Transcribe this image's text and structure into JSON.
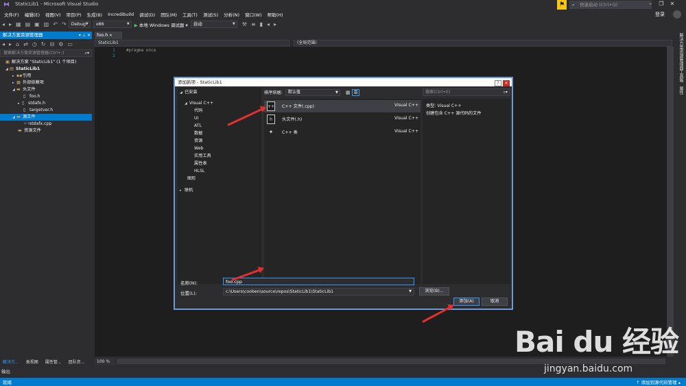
{
  "window": {
    "title": "StaticLib1 - Microsoft Visual Studio",
    "quick_launch_placeholder": "快速启动 (Ctrl+Q)",
    "login": "登录"
  },
  "menu": [
    "文件(F)",
    "编辑(E)",
    "视图(V)",
    "项目(P)",
    "生成(B)",
    "Incredibuild",
    "调试(D)",
    "团队(M)",
    "工具(T)",
    "测试(S)",
    "分析(N)",
    "窗口(W)",
    "帮助(H)"
  ],
  "toolbar": {
    "config": "Debug",
    "platform": "x86",
    "run_label": "本地 Windows 调试器",
    "run_mode": "自动"
  },
  "solution_explorer": {
    "header": "解决方案资源管理器",
    "search_placeholder": "搜索解决方案资源管理器(Ctrl+;)",
    "items": [
      {
        "label": "解决方案 \"StaticLib1\" (1 个项目)"
      },
      {
        "label": "StaticLib1"
      },
      {
        "label": "引用"
      },
      {
        "label": "外部依赖项"
      },
      {
        "label": "头文件"
      },
      {
        "label": "foo.h"
      },
      {
        "label": "stdafx.h"
      },
      {
        "label": "targetver.h"
      },
      {
        "label": "源文件"
      },
      {
        "label": "stdafx.cpp"
      },
      {
        "label": "资源文件"
      }
    ],
    "bottom_tabs": [
      "解决方...",
      "类视图",
      "属性管...",
      "团队资..."
    ]
  },
  "editor": {
    "tab": "foo.h",
    "nav_left": "StaticLib1",
    "nav_right": "(全局范围)",
    "line_numbers": [
      "1",
      "2"
    ],
    "code": "#pragma once",
    "zoom": "100 %"
  },
  "right_strip": [
    "解决方案资源管理器",
    "工具箱",
    "属性"
  ],
  "output_tab": "输出",
  "status": {
    "left": "就绪",
    "right": "添加到源代码管理"
  },
  "dialog": {
    "title": "添加新项 - StaticLib1",
    "categories_root": "已安装",
    "visual_cpp": "Visual C++",
    "subcategories": [
      "代码",
      "UI",
      "ATL",
      "数据",
      "资源",
      "Web",
      "实用工具",
      "属性表",
      "HLSL"
    ],
    "graphics": "图形",
    "online": "联机",
    "sort_label": "排序依据:",
    "sort_value": "默认值",
    "templates": [
      {
        "name": "C++ 文件(.cpp)",
        "lang": "Visual C++",
        "icon": "cpp-file-icon"
      },
      {
        "name": "头文件(.h)",
        "lang": "Visual C++",
        "icon": "header-file-icon"
      },
      {
        "name": "C++ 类",
        "lang": "Visual C++",
        "icon": "class-icon"
      }
    ],
    "search_placeholder": "搜索(Ctrl+E)",
    "detail_type": "类型:  Visual C++",
    "detail_desc": "创建包含 C++ 源代码的文件",
    "name_label": "名称(N):",
    "name_value": "foo.cpp",
    "location_label": "位置(L):",
    "location_value": "c:\\Users\\cooben\\source\\repos\\StaticLib1\\StaticLib1",
    "browse_label": "浏览(B)...",
    "add_label": "添加(A)",
    "cancel_label": "取消"
  },
  "watermark": {
    "logo": "Bai du 经验",
    "url": "jingyan.baidu.com"
  },
  "colors": {
    "accent": "#007acc",
    "annotation": "#e23030"
  }
}
